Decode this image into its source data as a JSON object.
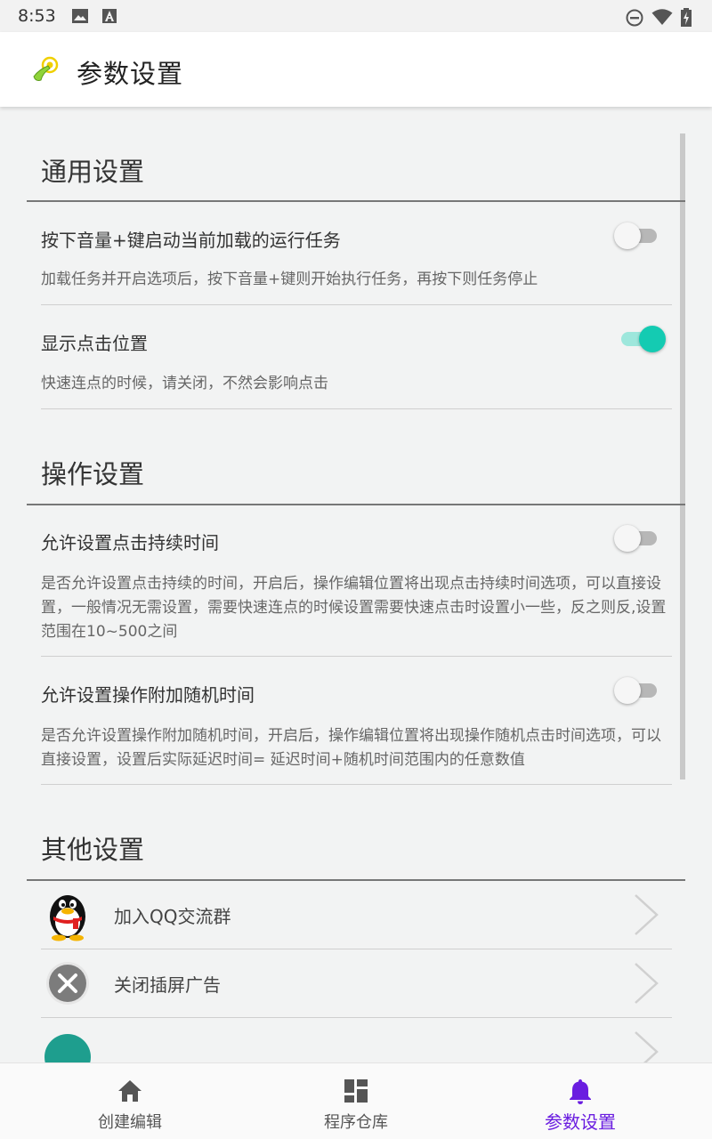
{
  "status_bar": {
    "time": "8:53"
  },
  "app_bar": {
    "title": "参数设置"
  },
  "sections": {
    "general": {
      "title": "通用设置",
      "items": [
        {
          "title": "按下音量+键启动当前加载的运行任务",
          "desc": "加载任务并开启选项后，按下音量+键则开始执行任务，再按下则任务停止",
          "enabled": false
        },
        {
          "title": "显示点击位置",
          "desc": "快速连点的时候，请关闭，不然会影响点击",
          "enabled": true
        }
      ]
    },
    "operation": {
      "title": "操作设置",
      "items": [
        {
          "title": "允许设置点击持续时间",
          "desc": "是否允许设置点击持续的时间，开启后，操作编辑位置将出现点击持续时间选项，可以直接设置，一般情况无需设置，需要快速连点的时候设置需要快速点击时设置小一些，反之则反,设置范围在10~500之间",
          "enabled": false
        },
        {
          "title": "允许设置操作附加随机时间",
          "desc": "是否允许设置操作附加随机时间，开启后，操作编辑位置将出现操作随机点击时间选项，可以直接设置，设置后实际延迟时间= 延迟时间+随机时间范围内的任意数值",
          "enabled": false
        }
      ]
    },
    "other": {
      "title": "其他设置",
      "items": [
        {
          "label": "加入QQ交流群",
          "icon": "qq-penguin-icon"
        },
        {
          "label": "关闭插屏广告",
          "icon": "close-circle-icon"
        }
      ]
    }
  },
  "bottom_nav": {
    "items": [
      {
        "label": "创建编辑",
        "icon": "home-icon",
        "active": false
      },
      {
        "label": "程序仓库",
        "icon": "dashboard-icon",
        "active": false
      },
      {
        "label": "参数设置",
        "icon": "bell-icon",
        "active": true
      }
    ]
  },
  "colors": {
    "accent": "#14cbb2",
    "nav_active": "#6a1de0"
  }
}
